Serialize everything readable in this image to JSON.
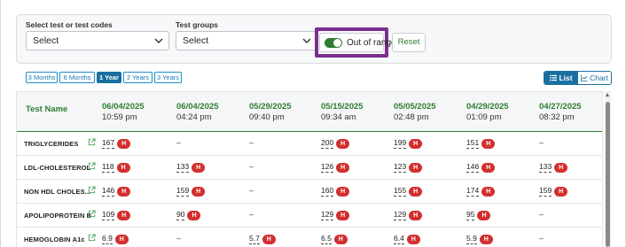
{
  "filters": {
    "test_label": "Select test or test codes",
    "test_value": "Select",
    "groups_label": "Test groups",
    "groups_value": "Select",
    "out_of_range_label": "Out of range",
    "out_of_range_on": true,
    "reset_label": "Reset"
  },
  "ranges": [
    "3 Months",
    "6 Months",
    "1 Year",
    "2 Years",
    "3 Years"
  ],
  "active_range": "1 Year",
  "view": {
    "list_label": "List",
    "chart_label": "Chart",
    "active": "List"
  },
  "table": {
    "test_header": "Test Name",
    "columns": [
      {
        "date": "06/04/2025",
        "time": "10:59 pm"
      },
      {
        "date": "06/04/2025",
        "time": "04:24 pm"
      },
      {
        "date": "05/29/2025",
        "time": "09:40 pm"
      },
      {
        "date": "05/15/2025",
        "time": "09:34 am"
      },
      {
        "date": "05/05/2025",
        "time": "02:48 pm"
      },
      {
        "date": "04/29/2025",
        "time": "01:09 pm"
      },
      {
        "date": "04/27/2025",
        "time": "08:32 pm"
      }
    ],
    "rows": [
      {
        "name": "TRIGLYCERIDES",
        "cells": [
          {
            "value": "167",
            "flag": "H"
          },
          {
            "value": "–"
          },
          {
            "value": "–"
          },
          {
            "value": "200",
            "flag": "H"
          },
          {
            "value": "199",
            "flag": "H"
          },
          {
            "value": "151",
            "flag": "H"
          },
          {
            "value": "–"
          }
        ]
      },
      {
        "name": "LDL-CHOLESTEROL",
        "cells": [
          {
            "value": "118",
            "flag": "H"
          },
          {
            "value": "133",
            "flag": "H"
          },
          {
            "value": "–"
          },
          {
            "value": "126",
            "flag": "H"
          },
          {
            "value": "123",
            "flag": "H"
          },
          {
            "value": "146",
            "flag": "H"
          },
          {
            "value": "133",
            "flag": "H"
          }
        ]
      },
      {
        "name": "NON HDL CHOLES...",
        "cells": [
          {
            "value": "146",
            "flag": "H"
          },
          {
            "value": "159",
            "flag": "H"
          },
          {
            "value": "–"
          },
          {
            "value": "160",
            "flag": "H"
          },
          {
            "value": "155",
            "flag": "H"
          },
          {
            "value": "174",
            "flag": "H"
          },
          {
            "value": "159",
            "flag": "H"
          }
        ]
      },
      {
        "name": "APOLIPOPROTEIN B",
        "cells": [
          {
            "value": "109",
            "flag": "H"
          },
          {
            "value": "90",
            "flag": "H"
          },
          {
            "value": "–"
          },
          {
            "value": "129",
            "flag": "H"
          },
          {
            "value": "129",
            "flag": "H"
          },
          {
            "value": "95",
            "flag": "H"
          },
          {
            "value": "–"
          }
        ]
      },
      {
        "name": "HEMOGLOBIN A1c",
        "cells": [
          {
            "value": "6.9",
            "flag": "H"
          },
          {
            "value": "–"
          },
          {
            "value": "5.7",
            "flag": "H"
          },
          {
            "value": "6.5",
            "flag": "H"
          },
          {
            "value": "6.4",
            "flag": "H"
          },
          {
            "value": "5.9",
            "flag": "H"
          },
          {
            "value": "–"
          }
        ]
      }
    ]
  },
  "colors": {
    "accent_green": "#2e7d32",
    "accent_blue": "#1a6fa0",
    "flag_red": "#d32f2f",
    "highlight_purple": "#7b2f8e"
  },
  "icons": {
    "dropdown": "chevron-down-icon",
    "external": "external-link-icon",
    "list": "list-icon",
    "chart": "chart-icon"
  }
}
